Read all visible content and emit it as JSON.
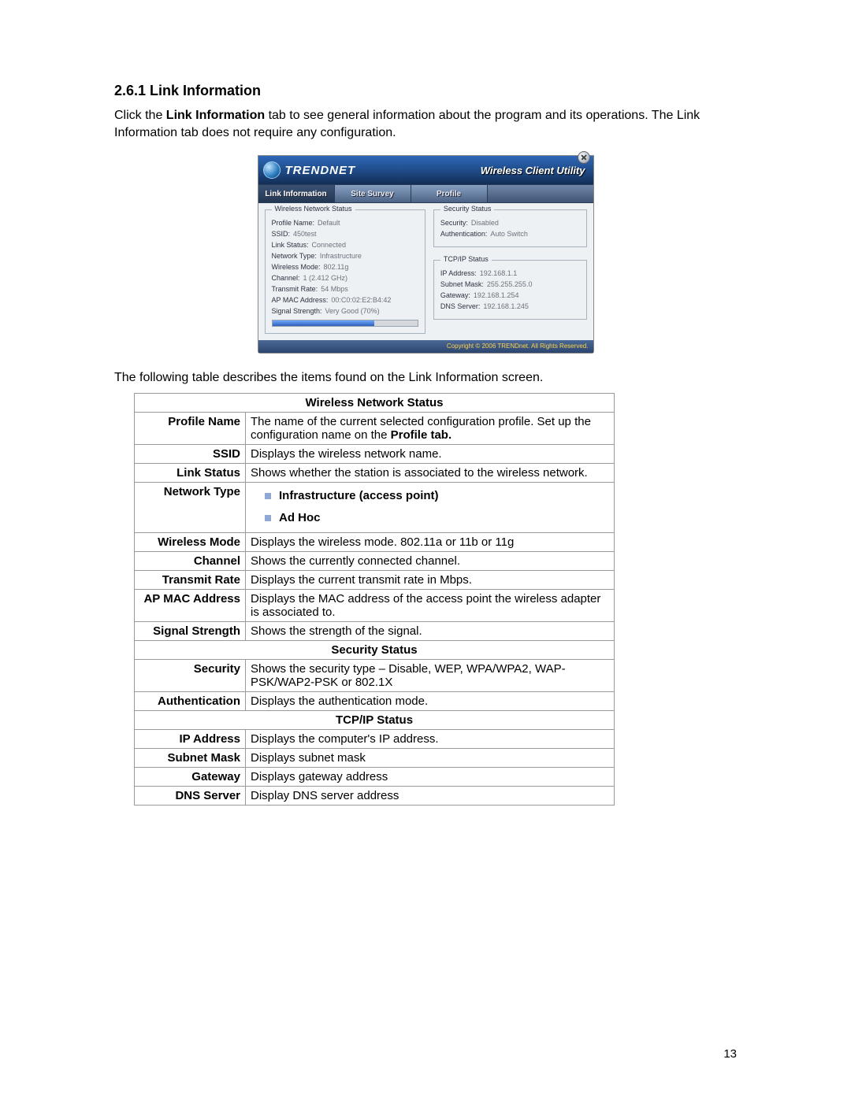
{
  "heading": "2.6.1 Link Information",
  "intro_pre": "Click the ",
  "intro_bold": "Link Information",
  "intro_post": " tab to see general information about the program and its operations. The Link Information tab does not require any configuration.",
  "app": {
    "brand": "TRENDNET",
    "title": "Wireless Client Utility",
    "tabs": {
      "link_info": "Link Information",
      "site_survey": "Site Survey",
      "profile": "Profile"
    },
    "wns_title": "Wireless Network Status",
    "wns": {
      "profile_name_k": "Profile Name:",
      "profile_name_v": "Default",
      "ssid_k": "SSID:",
      "ssid_v": "450test",
      "link_status_k": "Link Status:",
      "link_status_v": "Connected",
      "network_type_k": "Network Type:",
      "network_type_v": "Infrastructure",
      "wireless_mode_k": "Wireless Mode:",
      "wireless_mode_v": "802.11g",
      "channel_k": "Channel:",
      "channel_v": "1 (2.412 GHz)",
      "tx_rate_k": "Transmit Rate:",
      "tx_rate_v": "54 Mbps",
      "ap_mac_k": "AP MAC Address:",
      "ap_mac_v": "00:C0:02:E2:B4:42",
      "signal_k": "Signal Strength:",
      "signal_v": "Very Good (70%)"
    },
    "sec_title": "Security Status",
    "sec": {
      "security_k": "Security:",
      "security_v": "Disabled",
      "auth_k": "Authentication:",
      "auth_v": "Auto Switch"
    },
    "tcp_title": "TCP/IP Status",
    "tcp": {
      "ip_k": "IP Address:",
      "ip_v": "192.168.1.1",
      "mask_k": "Subnet Mask:",
      "mask_v": "255.255.255.0",
      "gw_k": "Gateway:",
      "gw_v": "192.168.1.254",
      "dns_k": "DNS Server:",
      "dns_v": "192.168.1.245"
    },
    "footer": "Copyright © 2006 TRENDnet. All Rights Reserved."
  },
  "desc_intro": "The following table describes the items found on the Link Information screen.",
  "table": {
    "wns_header": "Wireless Network Status",
    "profile_name_k": "Profile Name",
    "profile_name_v_pre": "The name of the current selected configuration profile.   Set up the configuration name on the ",
    "profile_name_v_b": "Profile tab.",
    "ssid_k": "SSID",
    "ssid_v": "Displays the wireless network name.",
    "link_status_k": "Link Status",
    "link_status_v": "Shows whether the station is associated to the wireless network.",
    "network_type_k": "Network Type",
    "nt_item1": "Infrastructure (access point)",
    "nt_item2": "Ad Hoc",
    "wireless_mode_k": "Wireless Mode",
    "wireless_mode_v": "Displays the wireless mode. 802.11a or 11b or 11g",
    "channel_k": "Channel",
    "channel_v": "Shows the currently connected channel.",
    "tx_rate_k": "Transmit Rate",
    "tx_rate_v": "Displays the current transmit rate in Mbps.",
    "ap_mac_k": "AP MAC Address",
    "ap_mac_v": "Displays the MAC address of the access point the wireless adapter is associated to.",
    "signal_k": "Signal Strength",
    "signal_v": "Shows the strength of the signal.",
    "sec_header": "Security Status",
    "security_k": "Security",
    "security_v": "Shows the security type – Disable, WEP, WPA/WPA2, WAP-PSK/WAP2-PSK or 802.1X",
    "auth_k": "Authentication",
    "auth_v": "Displays the authentication mode.",
    "tcp_header": "TCP/IP Status",
    "ip_k": "IP Address",
    "ip_v": "Displays the computer's IP address.",
    "mask_k": "Subnet  Mask",
    "mask_v": "Displays subnet mask",
    "gw_k": "Gateway",
    "gw_v": "Displays gateway address",
    "dns_k": "DNS  Server",
    "dns_v": "Display DNS server address"
  },
  "page_number": "13"
}
